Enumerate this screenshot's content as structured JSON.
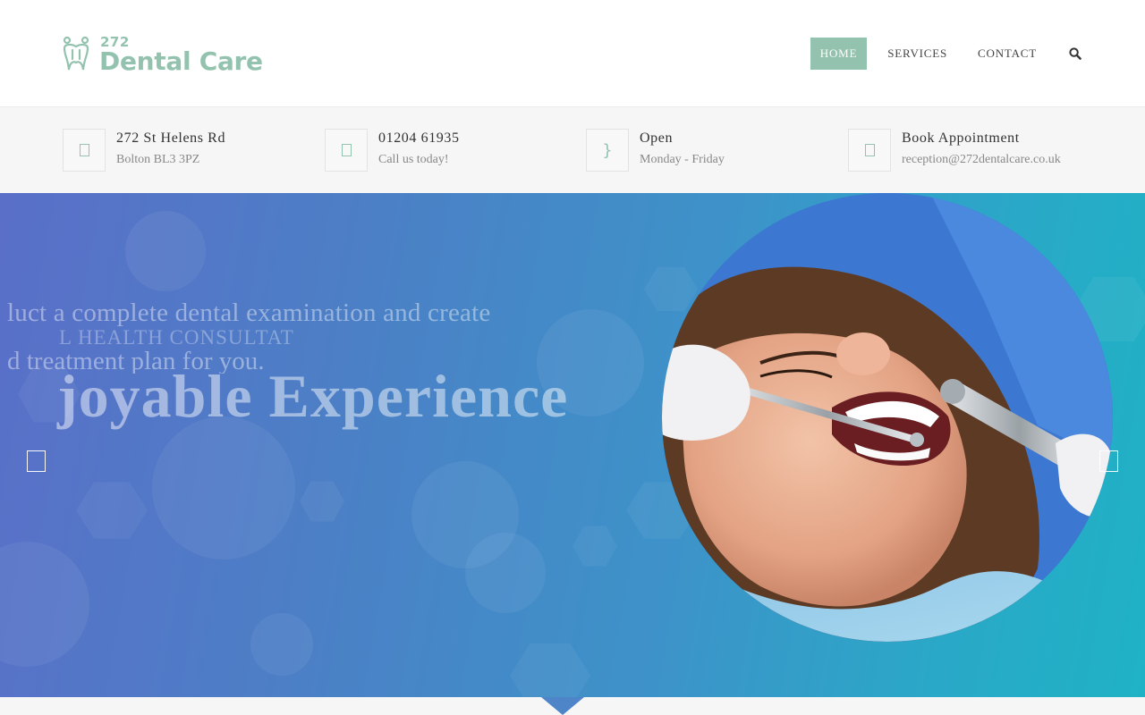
{
  "logo": {
    "number": "272",
    "name": "Dental Care"
  },
  "nav": {
    "items": [
      {
        "label": "HOME",
        "active": true
      },
      {
        "label": "SERVICES",
        "active": false
      },
      {
        "label": "CONTACT",
        "active": false
      }
    ],
    "search_icon": "search-icon"
  },
  "info": [
    {
      "icon": "map-pin-icon",
      "title": "272 St Helens Rd",
      "sub": "Bolton BL3 3PZ"
    },
    {
      "icon": "phone-icon",
      "title": "01204 61935",
      "sub": "Call us today!"
    },
    {
      "icon": "clock-icon",
      "title": "Open",
      "sub": "Monday - Friday"
    },
    {
      "icon": "calendar-icon",
      "title": "Book Appointment",
      "sub": "reception@272dentalcare.co.uk"
    }
  ],
  "hero": {
    "line1": "luct a complete dental examination and create",
    "caps": "L HEALTH CONSULTAT",
    "line2": "d treatment plan for you.",
    "big": "joyable Experience"
  },
  "colors": {
    "brand": "#93c3ae",
    "hero_start": "#5a6fc8",
    "hero_end": "#1fb2c6"
  }
}
